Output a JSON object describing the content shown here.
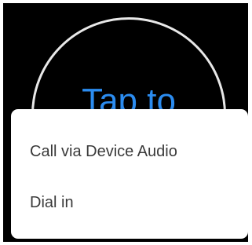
{
  "join_button": {
    "label": "Tap to",
    "accent_color": "#2b8cf0"
  },
  "audio_menu": {
    "items": [
      {
        "label": "Call via Device Audio"
      },
      {
        "label": "Dial in"
      }
    ]
  }
}
